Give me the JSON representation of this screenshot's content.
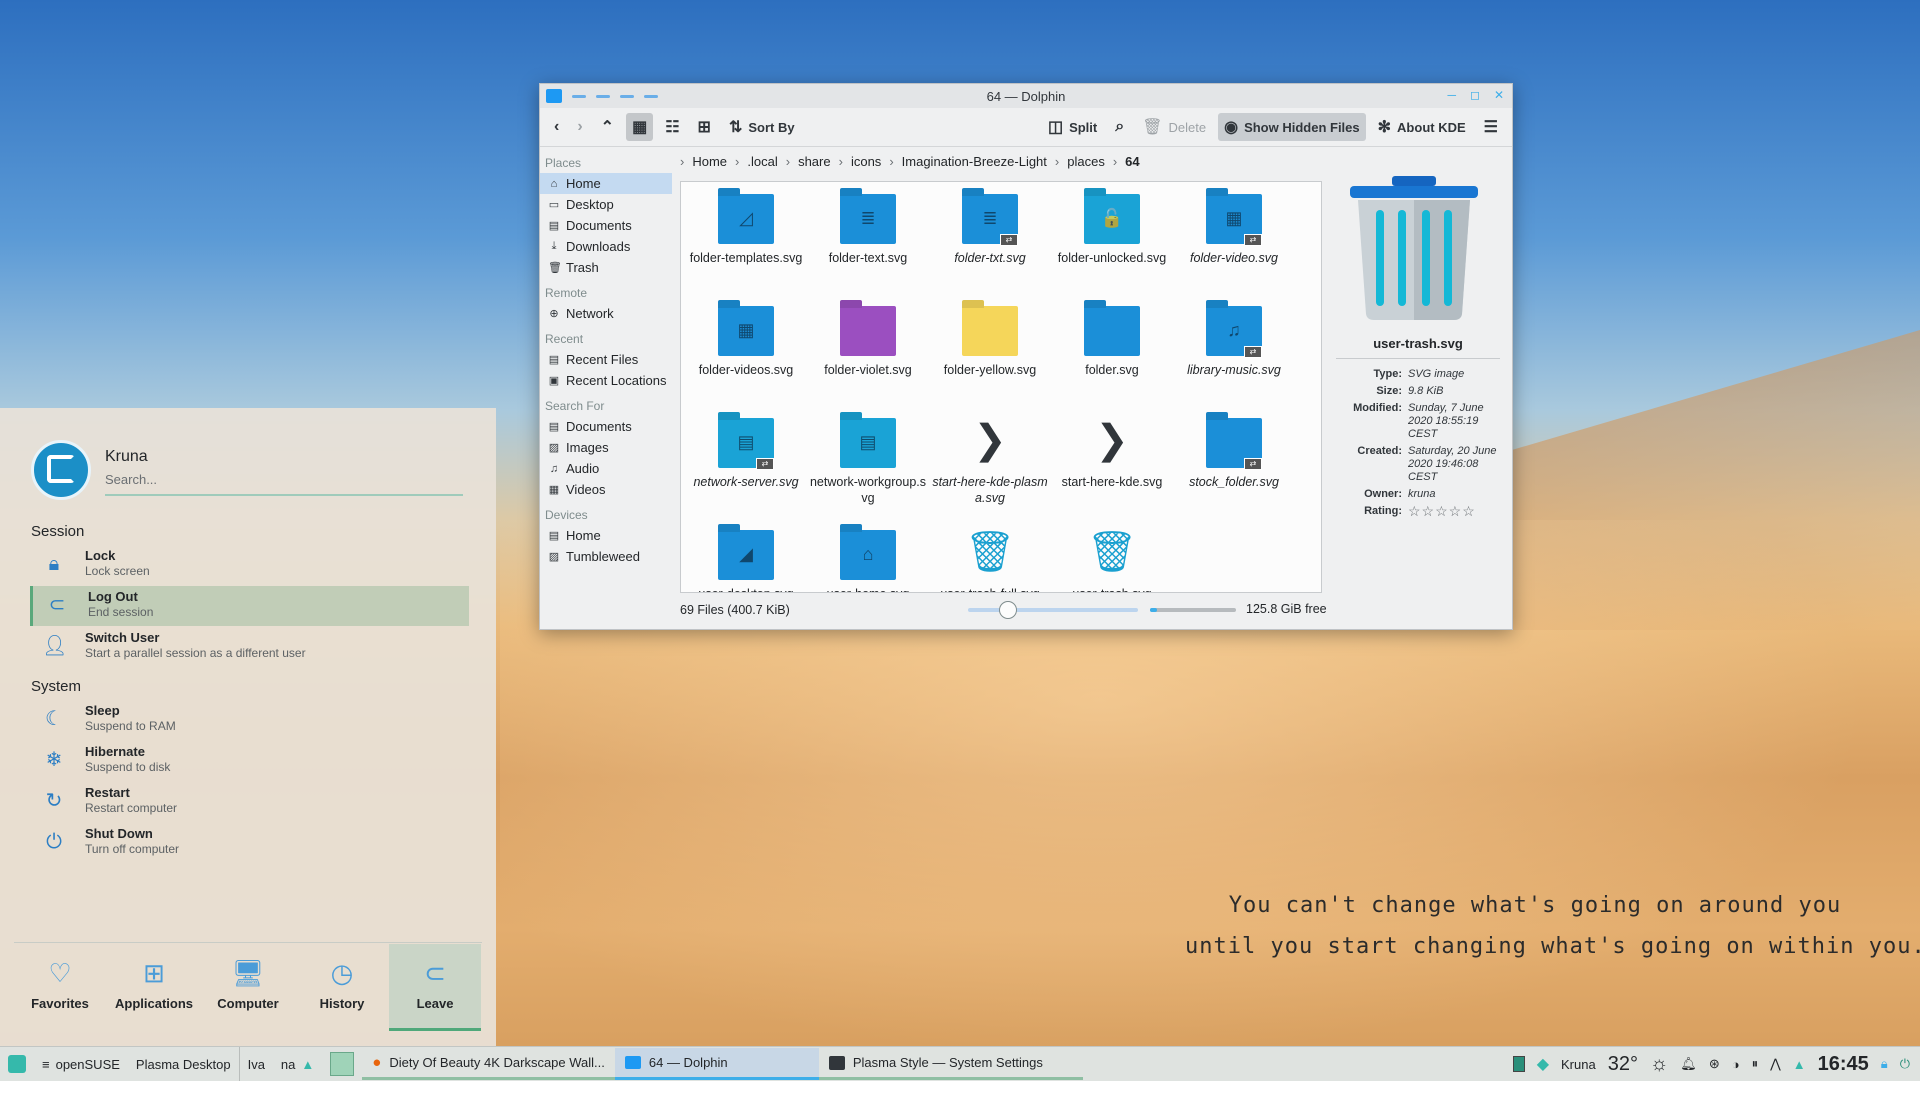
{
  "wallpaper": {
    "quote_line1": "You can't change what's going on around you",
    "quote_line2": "until you start changing what's going on within you."
  },
  "dolphin": {
    "title": "64 — Dolphin",
    "toolbar": {
      "sort_by": "Sort By",
      "split": "Split",
      "delete": "Delete",
      "show_hidden": "Show Hidden Files",
      "about_kde": "About KDE"
    },
    "places": {
      "heading": "Places",
      "items": [
        "Home",
        "Desktop",
        "Documents",
        "Downloads",
        "Trash"
      ]
    },
    "remote": {
      "heading": "Remote",
      "items": [
        "Network"
      ]
    },
    "recent": {
      "heading": "Recent",
      "items": [
        "Recent Files",
        "Recent Locations"
      ]
    },
    "search_for": {
      "heading": "Search For",
      "items": [
        "Documents",
        "Images",
        "Audio",
        "Videos"
      ]
    },
    "devices": {
      "heading": "Devices",
      "items": [
        "Home",
        "Tumbleweed"
      ]
    },
    "breadcrumb": [
      "Home",
      ".local",
      "share",
      "icons",
      "Imagination-Breeze-Light",
      "places",
      "64"
    ],
    "files": [
      {
        "name": "folder-templates.svg",
        "italic": false,
        "color": "#1b8fd8",
        "emblem": "◿"
      },
      {
        "name": "folder-text.svg",
        "italic": false,
        "color": "#1b8fd8",
        "emblem": "≣"
      },
      {
        "name": "folder-txt.svg",
        "italic": true,
        "color": "#1b8fd8",
        "emblem": "≣"
      },
      {
        "name": "folder-unlocked.svg",
        "italic": false,
        "color": "#1aa3d6",
        "emblem": "🔓"
      },
      {
        "name": "folder-video.svg",
        "italic": true,
        "color": "#1b8fd8",
        "emblem": "▦"
      },
      {
        "name": "folder-videos.svg",
        "italic": false,
        "color": "#1b8fd8",
        "emblem": "▦"
      },
      {
        "name": "folder-violet.svg",
        "italic": false,
        "color": "#9b4fc0",
        "emblem": ""
      },
      {
        "name": "folder-yellow.svg",
        "italic": false,
        "color": "#f5d65a",
        "emblem": ""
      },
      {
        "name": "folder.svg",
        "italic": false,
        "color": "#1b8fd8",
        "emblem": ""
      },
      {
        "name": "library-music.svg",
        "italic": true,
        "color": "#1b8fd8",
        "emblem": "♫"
      },
      {
        "name": "network-server.svg",
        "italic": true,
        "color": "#1aa3d6",
        "emblem": "▤"
      },
      {
        "name": "network-workgroup.svg",
        "italic": false,
        "color": "#1aa3d6",
        "emblem": "▤"
      },
      {
        "name": "start-here-kde-plasma.svg",
        "italic": true,
        "color": "",
        "emblem": "❯"
      },
      {
        "name": "start-here-kde.svg",
        "italic": false,
        "color": "",
        "emblem": "❯"
      },
      {
        "name": "stock_folder.svg",
        "italic": true,
        "color": "#1b8fd8",
        "emblem": ""
      },
      {
        "name": "user-desktop.svg",
        "italic": false,
        "color": "#1b8fd8",
        "emblem": "◢"
      },
      {
        "name": "user-home.svg",
        "italic": false,
        "color": "#1b8fd8",
        "emblem": "⌂"
      },
      {
        "name": "user-trash-full.svg",
        "italic": false,
        "color": "",
        "emblem": "🗑"
      },
      {
        "name": "user-trash.svg",
        "italic": false,
        "color": "",
        "emblem": "🗑"
      }
    ],
    "status": {
      "count": "69 Files (400.7 KiB)",
      "free": "125.8 GiB free",
      "zoom_percent": 23,
      "disk_used_percent": 8
    },
    "info": {
      "name": "user-trash.svg",
      "type_label": "Type:",
      "type": "SVG image",
      "size_label": "Size:",
      "size": "9.8 KiB",
      "modified_label": "Modified:",
      "modified": "Sunday, 7 June 2020 18:55:19 CEST",
      "created_label": "Created:",
      "created": "Saturday, 20 June 2020 19:46:08 CEST",
      "owner_label": "Owner:",
      "owner": "kruna",
      "rating_label": "Rating:",
      "rating": "☆☆☆☆☆"
    }
  },
  "launcher": {
    "user": "Kruna",
    "search_placeholder": "Search...",
    "session_heading": "Session",
    "system_heading": "System",
    "session": [
      {
        "title": "Lock",
        "sub": "Lock screen",
        "icon": "lock-icon"
      },
      {
        "title": "Log Out",
        "sub": "End session",
        "icon": "logout-icon"
      },
      {
        "title": "Switch User",
        "sub": "Start a parallel session as a different user",
        "icon": "switch-user-icon"
      }
    ],
    "system": [
      {
        "title": "Sleep",
        "sub": "Suspend to RAM",
        "icon": "sleep-icon"
      },
      {
        "title": "Hibernate",
        "sub": "Suspend to disk",
        "icon": "hibernate-icon"
      },
      {
        "title": "Restart",
        "sub": "Restart computer",
        "icon": "restart-icon"
      },
      {
        "title": "Shut Down",
        "sub": "Turn off computer",
        "icon": "shutdown-icon"
      }
    ],
    "tabs": [
      "Favorites",
      "Applications",
      "Computer",
      "History",
      "Leave"
    ]
  },
  "panel": {
    "menu1": "openSUSE",
    "menu2": "Plasma Desktop",
    "kb1": "Iva",
    "kb2": "na",
    "tasks": [
      "Diety Of Beauty 4K Darkscape Wall...",
      "64 — Dolphin",
      "Plasma Style — System Settings"
    ],
    "user": "Kruna",
    "temperature": "32°",
    "clock": "16:45"
  },
  "colors": {
    "accent": "#3daee9",
    "selection": "#c4daf1",
    "leave_accent": "#4fa87a"
  }
}
